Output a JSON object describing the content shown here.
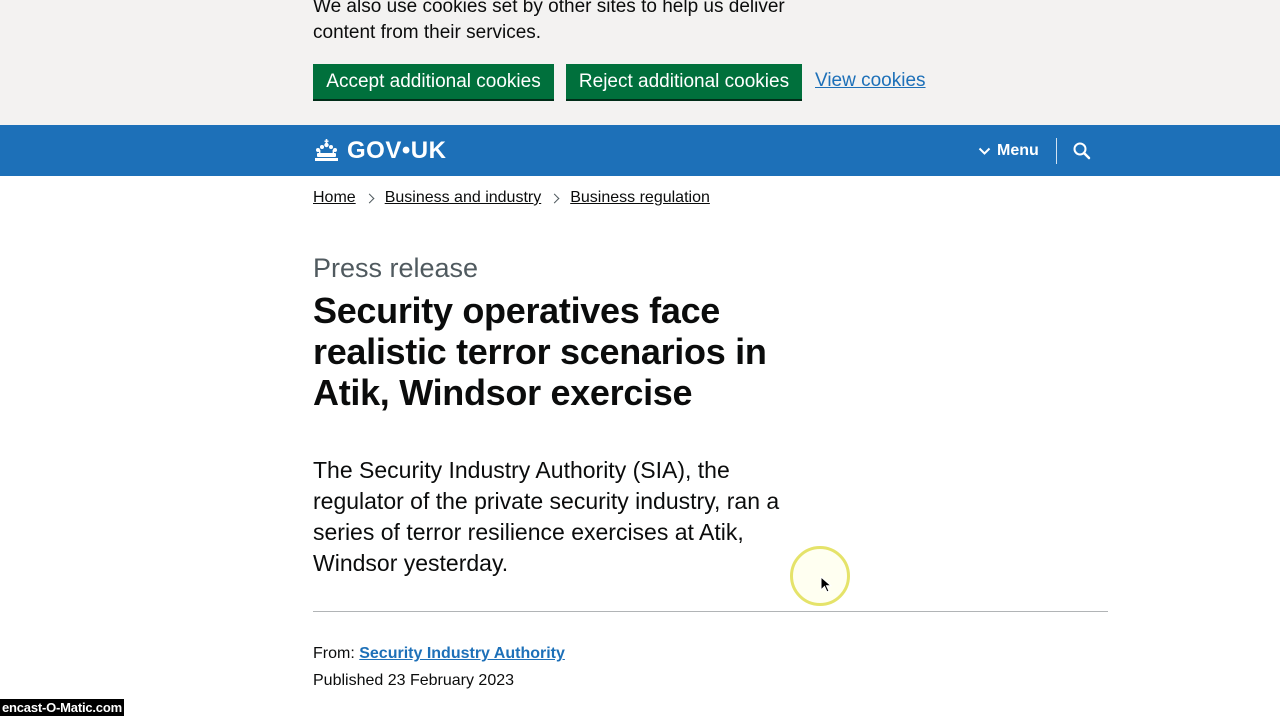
{
  "cookie_banner": {
    "text": "We also use cookies set by other sites to help us deliver content from their services.",
    "accept_label": "Accept additional cookies",
    "reject_label": "Reject additional cookies",
    "view_label": "View cookies",
    "accent_color": "#00703c",
    "link_color": "#1d70b8"
  },
  "header": {
    "logo_text": "GOV•UK",
    "logo_icon": "crown-icon",
    "menu_label": "Menu",
    "menu_icon": "chevron-down-icon",
    "search_icon": "search-icon",
    "background_color": "#1d70b8"
  },
  "breadcrumb": {
    "items": [
      {
        "label": "Home"
      },
      {
        "label": "Business and industry"
      },
      {
        "label": "Business regulation"
      }
    ]
  },
  "article": {
    "caption": "Press release",
    "title": "Security operatives face realistic terror scenarios in Atik, Windsor exercise",
    "lead": "The Security Industry Authority (SIA), the regulator of the private security industry, ran a series of terror resilience exercises at Atik, Windsor yesterday.",
    "from_label": "From:",
    "from_org": "Security Industry Authority",
    "published": "Published 23 February 2023"
  },
  "overlay": {
    "watermark": "encast-O-Matic.com",
    "cursor_icon": "mouse-pointer-icon"
  }
}
